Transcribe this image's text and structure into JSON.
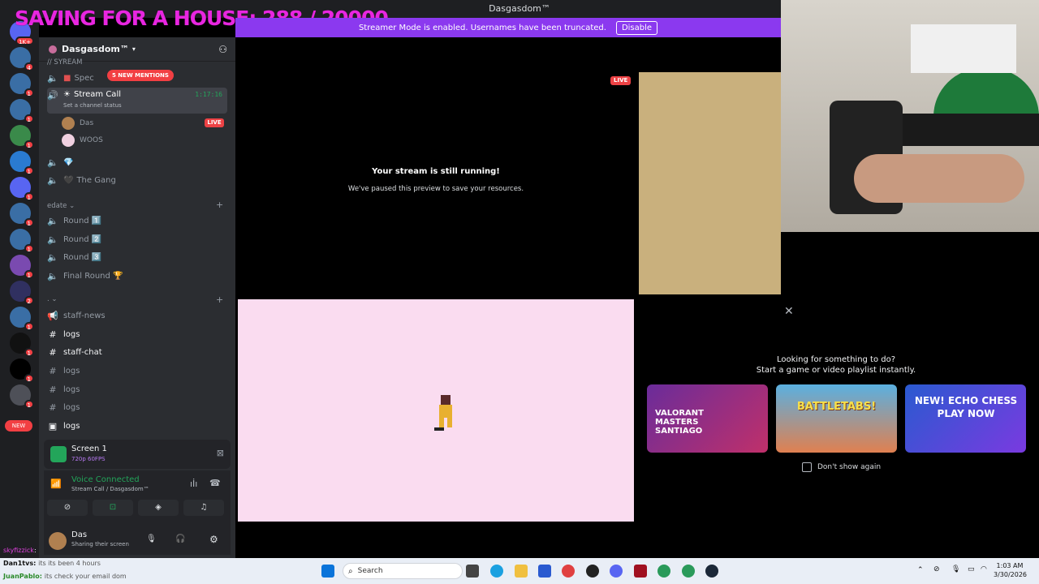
{
  "window": {
    "title": "Dasgasdom™"
  },
  "overlay_text": "SAVING FOR A HOUSE: 288 / 20000",
  "banner": {
    "text": "Streamer Mode is enabled. Usernames have been truncated.",
    "disable_label": "Disable"
  },
  "guild_badges": [
    "1K+",
    "4",
    "1",
    "1",
    "1",
    "1",
    "1",
    "1",
    "1",
    "1",
    "2",
    "1",
    "1",
    "1",
    "1"
  ],
  "new_badge": "NEW",
  "server": {
    "name": "Dasgasdom™"
  },
  "mentions_pill": "5 NEW MENTIONS",
  "channels": {
    "truncated_top": "// SYREAM",
    "spec": "Spec",
    "stream_call": {
      "name": "Stream Call",
      "timer": "1:17:16",
      "status": "Set a channel status"
    },
    "voice_users": [
      {
        "name": "Das",
        "live": "LIVE"
      },
      {
        "name": "WOOS"
      }
    ],
    "gem_channel": "💎",
    "the_gang": "The Gang",
    "category_edate": "edate",
    "rounds": [
      "Round 1️⃣",
      "Round 2️⃣",
      "Round 3️⃣",
      "Final Round 🏆"
    ],
    "category_dot": ".",
    "text_channels": [
      "staff-news",
      "logs",
      "staff-chat",
      "logs",
      "logs",
      "logs",
      "logs"
    ]
  },
  "screen_share": {
    "title": "Screen 1",
    "quality": "720p 60FPS"
  },
  "voice": {
    "status": "Voice Connected",
    "location": "Stream Call / Dasgasdom™"
  },
  "user": {
    "name": "Das",
    "status": "Sharing their screen"
  },
  "stream": {
    "live": "LIVE",
    "title": "Your stream is still running!",
    "subtitle": "We've paused this preview to save your resources."
  },
  "activity": {
    "heading1": "Looking for something to do?",
    "heading2": "Start a game or video playlist instantly.",
    "cards": [
      "VALORANT MASTERS SANTIAGO",
      "BATTLETABS!",
      "NEW! ECHO CHESS PLAY NOW"
    ],
    "dont_show": "Don't show again"
  },
  "chat_overlay": [
    {
      "user": "skyfizzick",
      "msg": ":"
    },
    {
      "user": "Dan1tvs",
      "msg": "its its been 4 hours"
    },
    {
      "user": "JuanPablo",
      "msg": "its check your email dom"
    }
  ],
  "taskbar": {
    "search": "Search",
    "time": "1:03 AM",
    "date": "3/30/2026"
  },
  "colors": {
    "accent": "#8b39ef",
    "live": "#ed4245",
    "voice_green": "#23a55a",
    "overlay_pink": "#e826e0"
  }
}
